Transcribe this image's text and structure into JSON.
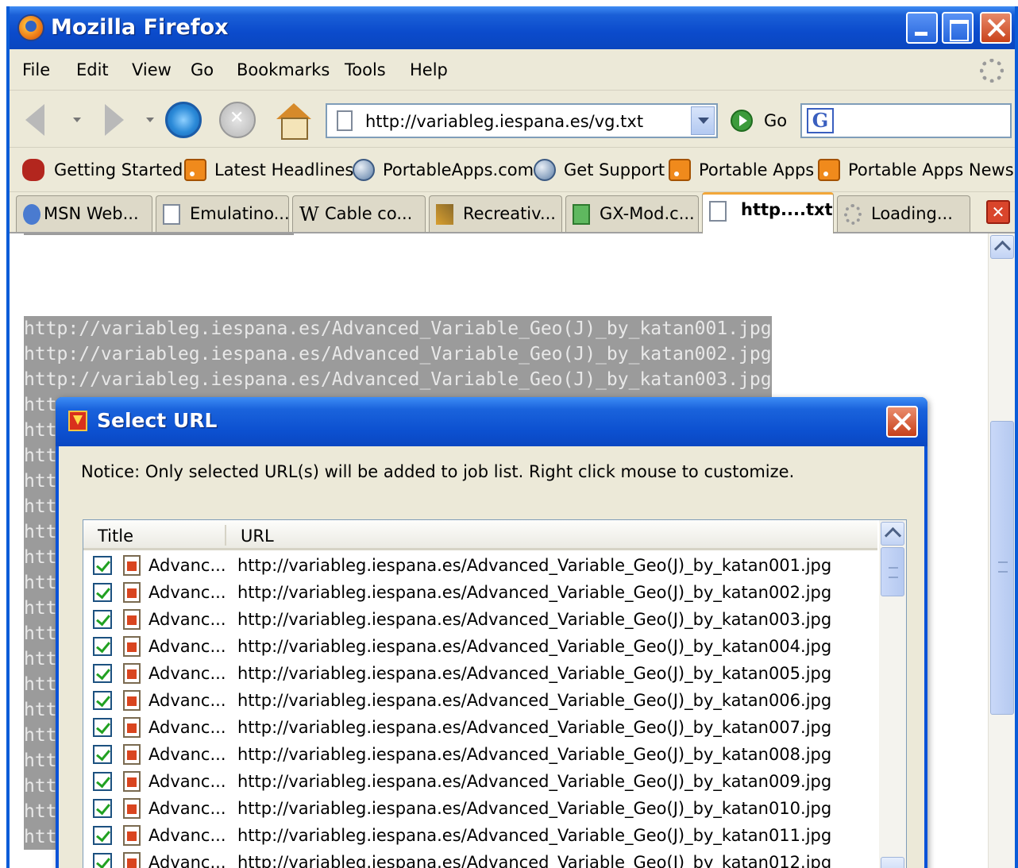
{
  "window": {
    "title": "Mozilla Firefox"
  },
  "menubar": {
    "items": [
      "File",
      "Edit",
      "View",
      "Go",
      "Bookmarks",
      "Tools",
      "Help"
    ]
  },
  "navbar": {
    "url": "http://variableg.iespana.es/vg.txt",
    "go_label": "Go",
    "search_engine_letter": "G"
  },
  "bookmarks": {
    "items": [
      {
        "label": "Getting Started",
        "icon": "bug-icon"
      },
      {
        "label": "Latest Headlines",
        "icon": "rss-icon"
      },
      {
        "label": "PortableApps.com",
        "icon": "globe-icon"
      },
      {
        "label": "Get Support",
        "icon": "globe-icon"
      },
      {
        "label": "Portable Apps",
        "icon": "rss-icon"
      },
      {
        "label": "Portable Apps News",
        "icon": "rss-icon"
      }
    ]
  },
  "tabs": [
    {
      "label": "MSN Web..."
    },
    {
      "label": "Emulatino..."
    },
    {
      "label": "Cable co..."
    },
    {
      "label": "Recreativ..."
    },
    {
      "label": "GX-Mod.c..."
    },
    {
      "label": "http....txt",
      "active": true
    },
    {
      "label": "Loading..."
    }
  ],
  "content": {
    "lines": [
      "http://variableg.iespana.es/Advanced_Variable_Geo(J)_by_katan001.jpg",
      "http://variableg.iespana.es/Advanced_Variable_Geo(J)_by_katan002.jpg",
      "http://variableg.iespana.es/Advanced_Variable_Geo(J)_by_katan003.jpg",
      "htt",
      "htt",
      "htt",
      "htt",
      "htt",
      "htt",
      "htt",
      "htt",
      "htt",
      "htt",
      "htt",
      "htt",
      "htt",
      "htt",
      "htt",
      "htt",
      "htt",
      "htt"
    ]
  },
  "dialog": {
    "title": "Select URL",
    "notice": "Notice: Only selected URL(s) will be added to job list. Right click mouse to customize.",
    "columns": {
      "title": "Title",
      "url": "URL"
    },
    "rows": [
      {
        "title": "Advanc...",
        "url": "http://variableg.iespana.es/Advanced_Variable_Geo(J)_by_katan001.jpg",
        "checked": true
      },
      {
        "title": "Advanc...",
        "url": "http://variableg.iespana.es/Advanced_Variable_Geo(J)_by_katan002.jpg",
        "checked": true
      },
      {
        "title": "Advanc...",
        "url": "http://variableg.iespana.es/Advanced_Variable_Geo(J)_by_katan003.jpg",
        "checked": true
      },
      {
        "title": "Advanc...",
        "url": "http://variableg.iespana.es/Advanced_Variable_Geo(J)_by_katan004.jpg",
        "checked": true
      },
      {
        "title": "Advanc...",
        "url": "http://variableg.iespana.es/Advanced_Variable_Geo(J)_by_katan005.jpg",
        "checked": true
      },
      {
        "title": "Advanc...",
        "url": "http://variableg.iespana.es/Advanced_Variable_Geo(J)_by_katan006.jpg",
        "checked": true
      },
      {
        "title": "Advanc...",
        "url": "http://variableg.iespana.es/Advanced_Variable_Geo(J)_by_katan007.jpg",
        "checked": true
      },
      {
        "title": "Advanc...",
        "url": "http://variableg.iespana.es/Advanced_Variable_Geo(J)_by_katan008.jpg",
        "checked": true
      },
      {
        "title": "Advanc...",
        "url": "http://variableg.iespana.es/Advanced_Variable_Geo(J)_by_katan009.jpg",
        "checked": true
      },
      {
        "title": "Advanc...",
        "url": "http://variableg.iespana.es/Advanced_Variable_Geo(J)_by_katan010.jpg",
        "checked": true
      },
      {
        "title": "Advanc...",
        "url": "http://variableg.iespana.es/Advanced_Variable_Geo(J)_by_katan011.jpg",
        "checked": true
      },
      {
        "title": "Advanc...",
        "url": "http://variableg.iespana.es/Advanced_Variable_Geo(J)_by_katan012.jpg",
        "checked": true
      }
    ]
  }
}
